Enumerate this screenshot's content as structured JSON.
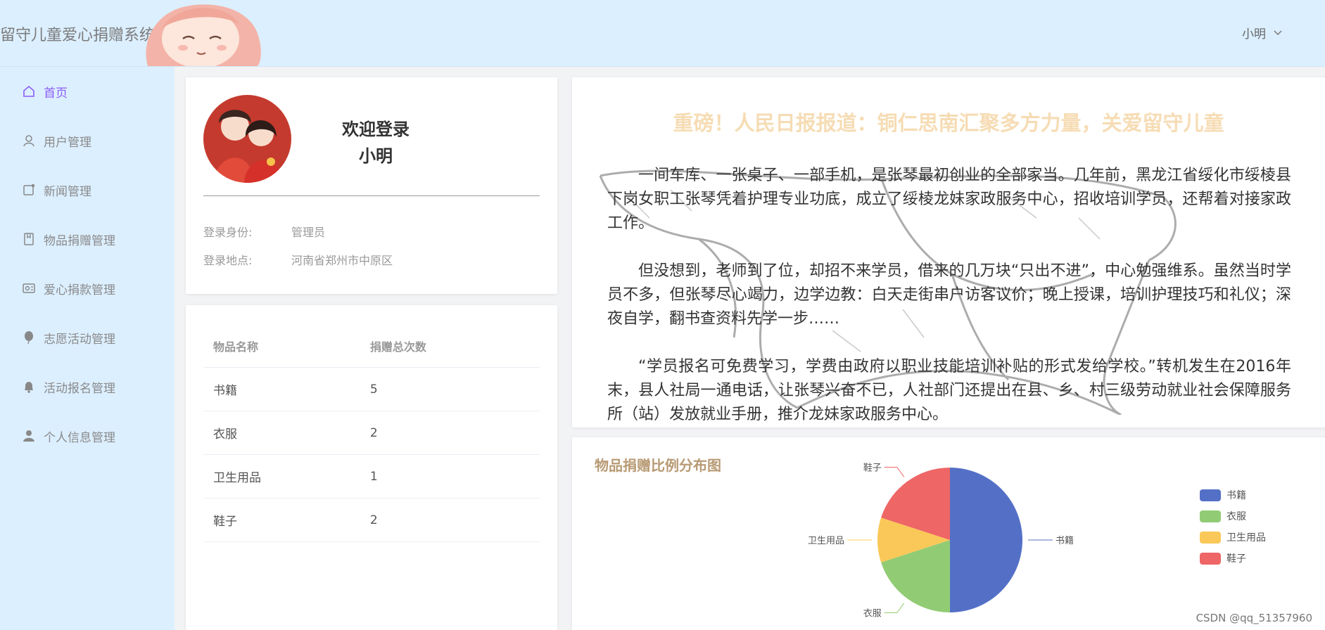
{
  "header": {
    "app_title": "留守儿童爱心捐赠系统",
    "user_name": "小明"
  },
  "sidebar": {
    "items": [
      {
        "label": "首页",
        "icon": "home-icon",
        "active": true
      },
      {
        "label": "用户管理",
        "icon": "user-icon"
      },
      {
        "label": "新闻管理",
        "icon": "news-icon"
      },
      {
        "label": "物品捐赠管理",
        "icon": "notebook-icon"
      },
      {
        "label": "爱心捐款管理",
        "icon": "wallet-icon"
      },
      {
        "label": "志愿活动管理",
        "icon": "balloon-icon"
      },
      {
        "label": "活动报名管理",
        "icon": "bell-icon"
      },
      {
        "label": "个人信息管理",
        "icon": "person-icon"
      }
    ]
  },
  "profile": {
    "welcome": "欢迎登录",
    "name": "小明",
    "role_label": "登录身份:",
    "role_value": "管理员",
    "location_label": "登录地点:",
    "location_value": "河南省郑州市中原区"
  },
  "donation_table": {
    "headers": [
      "物品名称",
      "捐赠总次数"
    ],
    "rows": [
      [
        "书籍",
        "5"
      ],
      [
        "衣服",
        "2"
      ],
      [
        "卫生用品",
        "1"
      ],
      [
        "鞋子",
        "2"
      ]
    ]
  },
  "news": {
    "title": "重磅！人民日报报道：铜仁思南汇聚多方力量，关爱留守儿童",
    "paragraphs": [
      "一间车库、一张桌子、一部手机，是张琴最初创业的全部家当。几年前，黑龙江省绥化市绥棱县下岗女职工张琴凭着护理专业功底，成立了绥棱龙妹家政服务中心，招收培训学员，还帮着对接家政工作。",
      "但没想到，老师到了位，却招不来学员，借来的几万块“只出不进”，中心勉强维系。虽然当时学员不多，但张琴尽心竭力，边学边教：白天走街串户访客议价；晚上授课，培训护理技巧和礼仪；深夜自学，翻书查资料先学一步……",
      "“学员报名可免费学习，学费由政府以职业技能培训补贴的形式发给学校。”转机发生在2016年末，县人社局一通电话，让张琴兴奋不已，人社部门还提出在县、乡、村三级劳动就业社会保障服务所（站）发放就业手册，推介龙妹家政服务中心。"
    ]
  },
  "chart_data": {
    "type": "pie",
    "title": "物品捐赠比例分布图",
    "categories": [
      "书籍",
      "衣服",
      "卫生用品",
      "鞋子"
    ],
    "values": [
      5,
      2,
      1,
      2
    ],
    "colors": [
      "#5470c6",
      "#91cc75",
      "#fac858",
      "#ee6666"
    ],
    "legend_position": "right"
  },
  "watermark": "CSDN @qq_51357960"
}
